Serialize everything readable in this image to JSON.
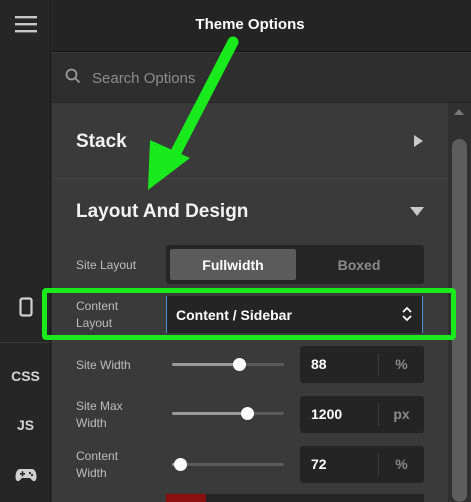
{
  "rail": {
    "menu_icon": "hamburger-menu-icon",
    "device_icon": "mobile-device-icon",
    "css_label": "CSS",
    "js_label": "JS",
    "game_icon": "gamepad-icon"
  },
  "header": {
    "title": "Theme Options"
  },
  "search": {
    "placeholder": "Search Options"
  },
  "sections": {
    "stack": {
      "title": "Stack"
    },
    "layout": {
      "title": "Layout And Design"
    }
  },
  "site_layout": {
    "label": "Site Layout",
    "options": [
      "Fullwidth",
      "Boxed"
    ],
    "selected": "Fullwidth"
  },
  "content_layout": {
    "label_line1": "Content",
    "label_line2": "Layout",
    "value": "Content / Sidebar"
  },
  "site_width": {
    "label": "Site Width",
    "value": "88",
    "unit": "%",
    "slider_fraction": 0.6
  },
  "site_max_width": {
    "label_line1": "Site Max",
    "label_line2": "Width",
    "value": "1200",
    "unit": "px",
    "slider_fraction": 0.67
  },
  "content_width": {
    "label_line1": "Content",
    "label_line2": "Width",
    "value": "72",
    "unit": "%",
    "slider_fraction": 0.07
  },
  "colors": {
    "highlight": "#19ea1c",
    "accent_border": "#4d8fd6",
    "partial_swatch": "#8a0f0f"
  }
}
